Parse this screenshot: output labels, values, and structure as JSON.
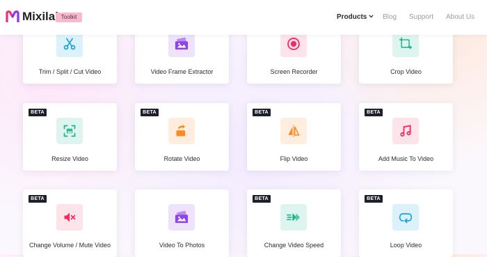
{
  "header": {
    "brand": "Mixilab",
    "badge": "Toolkit",
    "nav": [
      {
        "label": "Products",
        "active": true
      },
      {
        "label": "Blog"
      },
      {
        "label": "Support"
      },
      {
        "label": "About Us"
      }
    ]
  },
  "tools": [
    {
      "label": "Trim / Split / Cut Video",
      "beta": false,
      "icon": "scissors-icon"
    },
    {
      "label": "Video Frame Extractor",
      "beta": false,
      "icon": "photo-frame-icon"
    },
    {
      "label": "Screen Recorder",
      "beta": false,
      "icon": "record-icon"
    },
    {
      "label": "Crop Video",
      "beta": false,
      "icon": "crop-icon"
    },
    {
      "label": "Resize Video",
      "beta": true,
      "beta_label": "BETA",
      "icon": "resize-icon"
    },
    {
      "label": "Rotate Video",
      "beta": true,
      "beta_label": "BETA",
      "icon": "rotate-icon"
    },
    {
      "label": "Flip Video",
      "beta": true,
      "beta_label": "BETA",
      "icon": "flip-icon"
    },
    {
      "label": "Add Music To Video",
      "beta": true,
      "beta_label": "BETA",
      "icon": "music-note-icon"
    },
    {
      "label": "Change Volume / Mute Video",
      "beta": true,
      "beta_label": "BETA",
      "icon": "mute-icon"
    },
    {
      "label": "Video To Photos",
      "beta": false,
      "icon": "photos-icon"
    },
    {
      "label": "Change Video Speed",
      "beta": true,
      "beta_label": "BETA",
      "icon": "speed-icon"
    },
    {
      "label": "Loop Video",
      "beta": true,
      "beta_label": "BETA",
      "icon": "loop-icon"
    }
  ],
  "colors": {
    "scissors-icon": {
      "bg": "#dcf2fb",
      "fg": "#1aa1d8"
    },
    "photo-frame-icon": {
      "bg": "#eee3fb",
      "fg": "#8e44e6"
    },
    "record-icon": {
      "bg": "#fde3ea",
      "fg": "#ee2d63"
    },
    "crop-icon": {
      "bg": "#ddf5ee",
      "fg": "#1fb389"
    },
    "resize-icon": {
      "bg": "#ddf5ee",
      "fg": "#1fb389"
    },
    "rotate-icon": {
      "bg": "#ffeede",
      "fg": "#fb8a22"
    },
    "flip-icon": {
      "bg": "#ffeede",
      "fg": "#fb8a22"
    },
    "music-note-icon": {
      "bg": "#fde3ea",
      "fg": "#ee2d63"
    },
    "mute-icon": {
      "bg": "#fde3ea",
      "fg": "#ee2d63"
    },
    "photos-icon": {
      "bg": "#eee3fb",
      "fg": "#8e44e6"
    },
    "speed-icon": {
      "bg": "#ddf5ee",
      "fg": "#1fb389"
    },
    "loop-icon": {
      "bg": "#dcf2fb",
      "fg": "#1aa1d8"
    }
  }
}
